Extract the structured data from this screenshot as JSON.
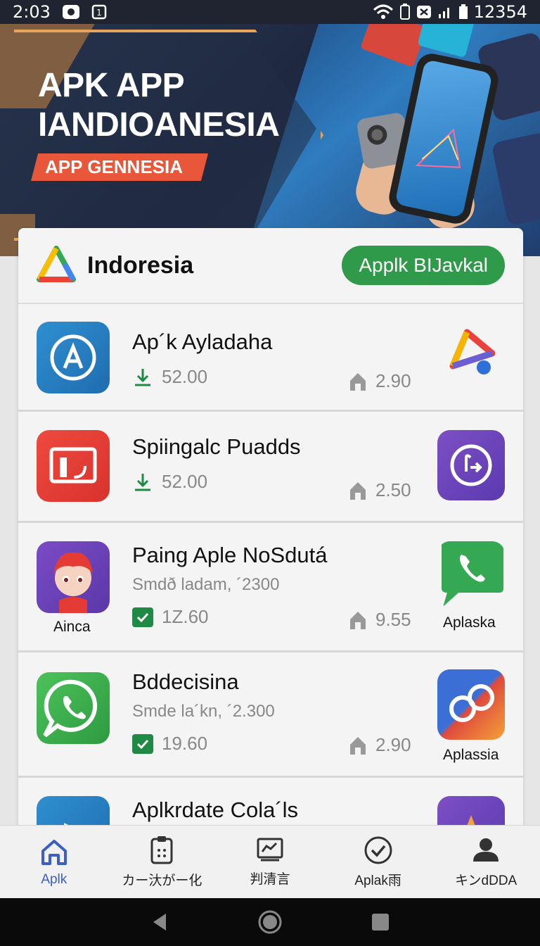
{
  "status_bar": {
    "time": "2:03",
    "right_text": "12354"
  },
  "banner": {
    "title_line1": "APK APP",
    "title_line2": "IANDIOANESIA",
    "tag": "APP GENNESIA"
  },
  "header": {
    "brand_name": "Indoresia",
    "button_label": "Applk BIJavkal"
  },
  "apps": [
    {
      "title": "Ap´k Ayladaha",
      "subtitle": "",
      "left_stat": "52.00",
      "right_stat": "2.90",
      "left_caption": "",
      "right_caption": ""
    },
    {
      "title": "Spiingalc Puadds",
      "subtitle": "",
      "left_stat": "52.00",
      "right_stat": "2.50",
      "left_caption": "",
      "right_caption": ""
    },
    {
      "title": "Paing Aple NoSdutá",
      "subtitle": "Smdð ladam, ´2300",
      "left_stat": "1Z.60",
      "right_stat": "9.55",
      "left_caption": "Ainca",
      "right_caption": "Aplaska"
    },
    {
      "title": "Bddecisina",
      "subtitle": "Smde la´kn, ´2.300",
      "left_stat": "19.60",
      "right_stat": "2.90",
      "left_caption": "",
      "right_caption": "Aplassia"
    },
    {
      "title": "Aplkrdate Cola´ls",
      "subtitle": "",
      "left_stat": "",
      "right_stat": "",
      "left_caption": "",
      "right_caption": ""
    }
  ],
  "bottom_nav": [
    {
      "label": "Aplk",
      "icon": "home-icon",
      "active": true
    },
    {
      "label": "カー汏がー化",
      "icon": "clipboard-icon",
      "active": false
    },
    {
      "label": "判清言",
      "icon": "chart-icon",
      "active": false
    },
    {
      "label": "Aplak雨",
      "icon": "check-circle-icon",
      "active": false
    },
    {
      "label": "キンdDDA",
      "icon": "person-icon",
      "active": false
    }
  ],
  "colors": {
    "accent_green": "#2f9a4a",
    "nav_active": "#3d5fc4",
    "banner_tag": "#e8573a"
  }
}
